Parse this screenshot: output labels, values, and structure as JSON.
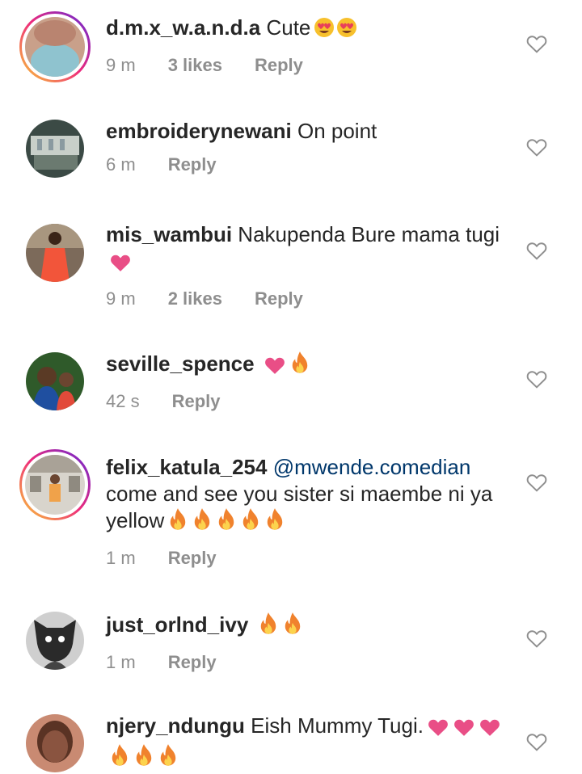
{
  "colors": {
    "text": "#262626",
    "meta": "#8e8e8e",
    "mention": "#00376b",
    "heart": "#e94e86",
    "fire": "#f0822d"
  },
  "comments": [
    {
      "username": "d.m.x_w.a.n.d.a",
      "text": "Cute",
      "emoji": [
        "heart-eyes",
        "heart-eyes"
      ],
      "time": "9 m",
      "likes": "3 likes",
      "reply": "Reply",
      "story_ring": true,
      "avatar": "avatar-1"
    },
    {
      "username": "embroiderynewani",
      "text": "On point",
      "emoji": [],
      "time": "6 m",
      "likes": "",
      "reply": "Reply",
      "story_ring": false,
      "avatar": "avatar-2"
    },
    {
      "username": "mis_wambui",
      "text": "Nakupenda Bure mama tugi",
      "emoji": [
        "pink-heart"
      ],
      "time": "9 m",
      "likes": "2 likes",
      "reply": "Reply",
      "story_ring": false,
      "avatar": "avatar-3"
    },
    {
      "username": "seville_spence",
      "text": "",
      "emoji": [
        "pink-heart",
        "fire"
      ],
      "time": "42 s",
      "likes": "",
      "reply": "Reply",
      "story_ring": false,
      "avatar": "avatar-4"
    },
    {
      "username": "felix_katula_254",
      "mention": "@mwende.comedian",
      "text": "come and see you sister si maembe ni ya yellow",
      "emoji": [
        "fire",
        "fire",
        "fire",
        "fire",
        "fire"
      ],
      "time": "1 m",
      "likes": "",
      "reply": "Reply",
      "story_ring": true,
      "avatar": "avatar-5"
    },
    {
      "username": "just_orlnd_ivy",
      "text": "",
      "emoji": [
        "fire",
        "fire"
      ],
      "time": "1 m",
      "likes": "",
      "reply": "Reply",
      "story_ring": false,
      "avatar": "avatar-6"
    },
    {
      "username": "njery_ndungu",
      "text": "Eish Mummy Tugi.",
      "emoji": [
        "pink-heart",
        "pink-heart",
        "pink-heart",
        "fire",
        "fire",
        "fire"
      ],
      "time": "",
      "likes": "",
      "reply": "",
      "story_ring": false,
      "avatar": "avatar-7"
    }
  ]
}
